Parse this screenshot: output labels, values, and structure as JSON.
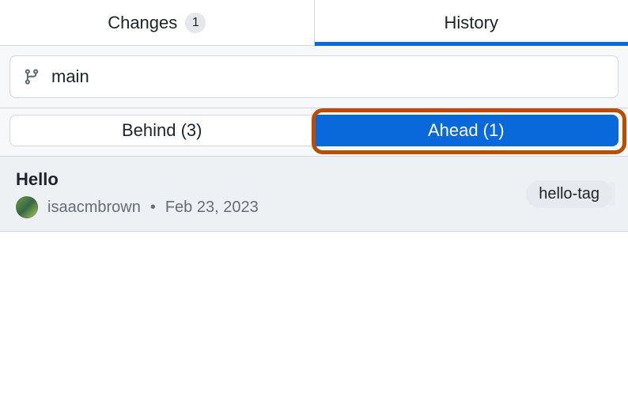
{
  "tabs": {
    "changes_label": "Changes",
    "changes_count": "1",
    "history_label": "History"
  },
  "branch": {
    "name": "main"
  },
  "segmented": {
    "behind_label": "Behind (3)",
    "ahead_label": "Ahead (1)"
  },
  "commit": {
    "title": "Hello",
    "author": "isaacmbrown",
    "separator": "•",
    "date": "Feb 23, 2023",
    "tag": "hello-tag"
  }
}
